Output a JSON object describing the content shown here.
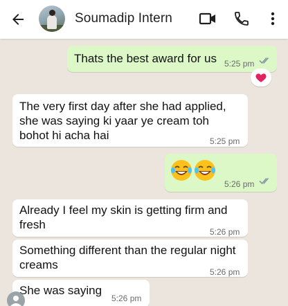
{
  "header": {
    "contact_name": "Soumadip Intern",
    "icons": [
      "back-arrow-icon",
      "video-call-icon",
      "phone-icon",
      "more-vert-icon"
    ]
  },
  "messages": [
    {
      "direction": "outgoing",
      "text": "Thats the best award for us",
      "time": "5:25 pm",
      "status": "read",
      "reaction": "heart"
    },
    {
      "direction": "incoming",
      "text_lines": [
        "The very first day after she had applied,",
        "she was saying ki yaar ye cream toh",
        "bohot hi acha hai"
      ],
      "time": "5:25 pm"
    },
    {
      "direction": "outgoing",
      "emoji": "😂😂",
      "time": "5:26 pm",
      "status": "read"
    },
    {
      "direction": "incoming",
      "text_lines": [
        "Already I feel my skin is getting firm and",
        "fresh"
      ],
      "time": "5:26 pm"
    },
    {
      "direction": "incoming",
      "text_lines": [
        "Something different than the regular night",
        "creams"
      ],
      "time": "5:26 pm"
    },
    {
      "direction": "incoming",
      "text_lines": [
        "She was saying"
      ],
      "time": "5:26 pm"
    }
  ],
  "colors": {
    "background": "#ece5dd",
    "outgoing_bubble": "#dcf8c6",
    "incoming_bubble": "#ffffff",
    "read_ticks": "#8696a0",
    "reaction_heart": "#e0245e"
  }
}
